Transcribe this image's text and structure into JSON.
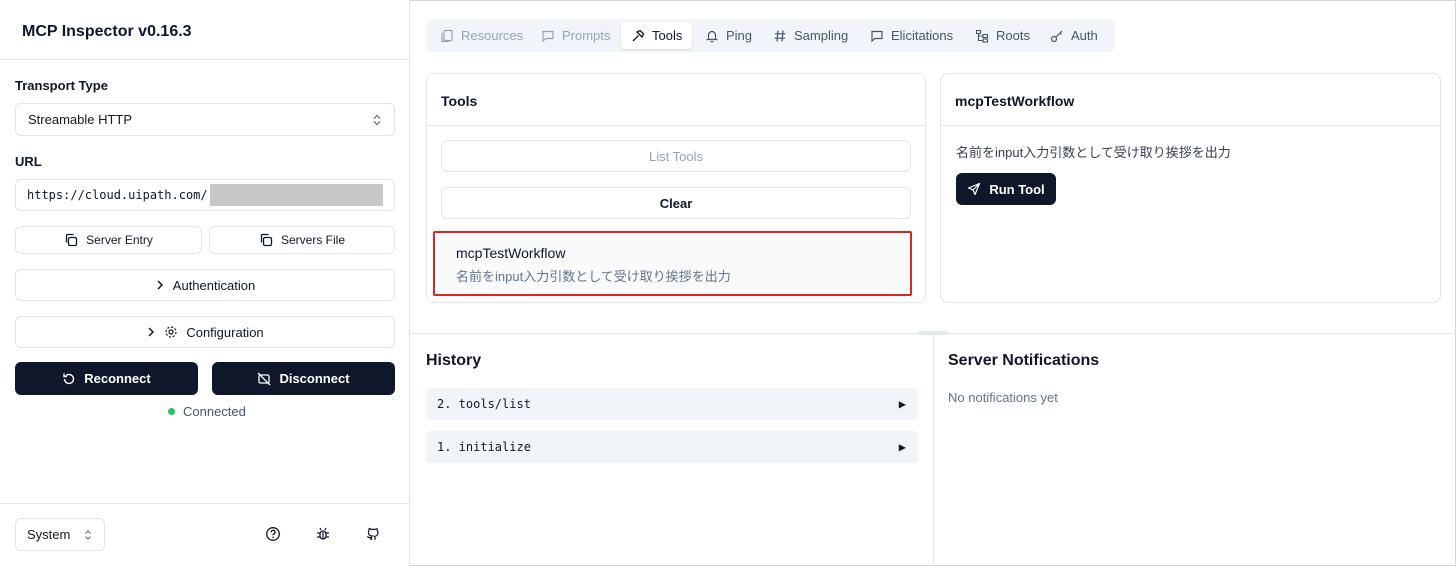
{
  "app": {
    "title": "MCP Inspector v0.16.3"
  },
  "sidebar": {
    "transport_label": "Transport Type",
    "transport_value": "Streamable HTTP",
    "url_label": "URL",
    "url_value": "https://cloud.uipath.com/",
    "server_entry_label": "Server Entry",
    "servers_file_label": "Servers File",
    "authentication_label": "Authentication",
    "configuration_label": "Configuration",
    "reconnect_label": "Reconnect",
    "disconnect_label": "Disconnect",
    "status_text": "Connected",
    "status_color": "#22c55e",
    "theme_value": "System"
  },
  "tabs": [
    {
      "label": "Resources",
      "icon": "files-icon",
      "state": "disabled"
    },
    {
      "label": "Prompts",
      "icon": "message-square-icon",
      "state": "disabled"
    },
    {
      "label": "Tools",
      "icon": "hammer-icon",
      "state": "active"
    },
    {
      "label": "Ping",
      "icon": "bell-icon",
      "state": "normal"
    },
    {
      "label": "Sampling",
      "icon": "hash-icon",
      "state": "normal"
    },
    {
      "label": "Elicitations",
      "icon": "message-square-icon",
      "state": "normal"
    },
    {
      "label": "Roots",
      "icon": "folder-tree-icon",
      "state": "normal"
    },
    {
      "label": "Auth",
      "icon": "key-icon",
      "state": "normal"
    }
  ],
  "tools_panel": {
    "title": "Tools",
    "list_tools_label": "List Tools",
    "clear_label": "Clear",
    "items": [
      {
        "name": "mcpTestWorkflow",
        "description": "名前をinput入力引数として受け取り挨拶を出力"
      }
    ]
  },
  "tool_detail": {
    "title": "mcpTestWorkflow",
    "description": "名前をinput入力引数として受け取り挨拶を出力",
    "run_label": "Run Tool"
  },
  "history": {
    "title": "History",
    "items": [
      {
        "label": "2. tools/list"
      },
      {
        "label": "1. initialize"
      }
    ]
  },
  "notifications": {
    "title": "Server Notifications",
    "empty_text": "No notifications yet"
  },
  "colors": {
    "accent_dark": "#0f172a",
    "highlight_border": "#dc2626"
  }
}
